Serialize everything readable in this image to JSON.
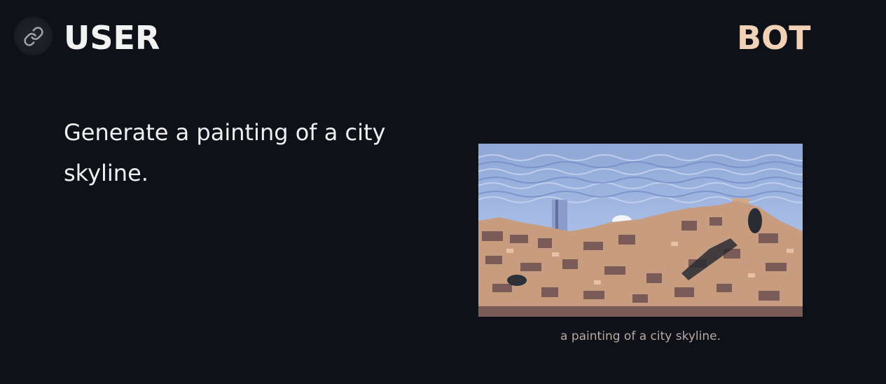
{
  "header": {
    "user_label": "USER",
    "bot_label": "BOT",
    "avatar_icon": "link-icon"
  },
  "user_message": {
    "text": "Generate a painting of a city skyline."
  },
  "bot_message": {
    "image_icon": "city-skyline-painting",
    "caption": "a painting of a city skyline."
  },
  "colors": {
    "background": "#0e1117",
    "user_label": "#f2f2f2",
    "bot_label": "#f2d2b6",
    "caption": "#b8a9a5"
  }
}
